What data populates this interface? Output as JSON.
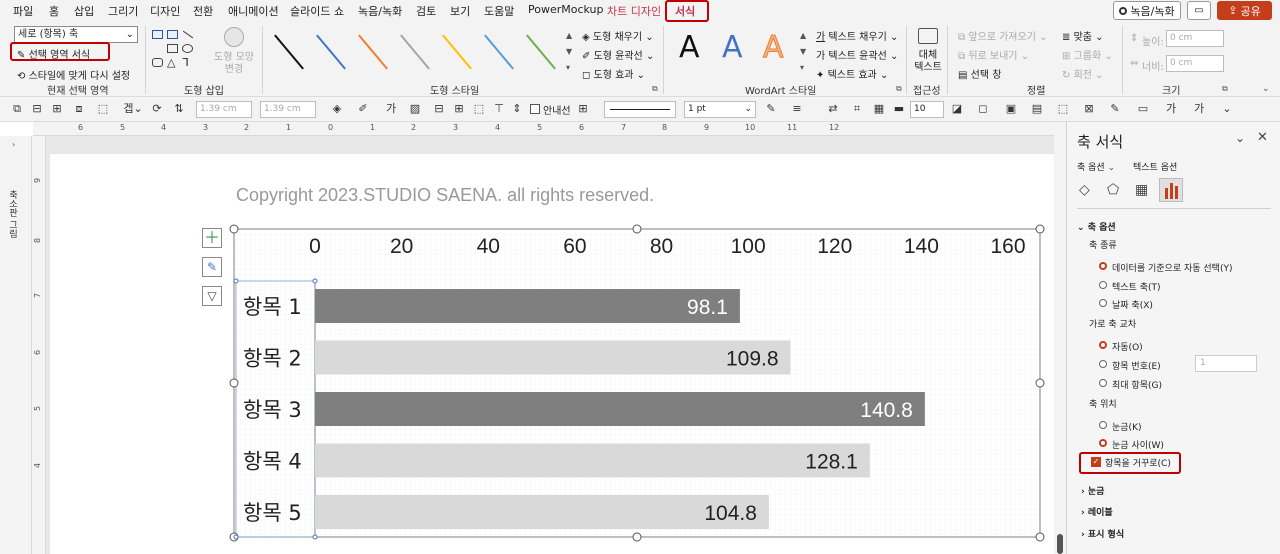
{
  "menu": {
    "items": [
      "파일",
      "홈",
      "삽입",
      "그리기",
      "디자인",
      "전환",
      "애니메이션",
      "슬라이드 쇼",
      "녹음/녹화",
      "검토",
      "보기",
      "도움말",
      "PowerMockup",
      "차트 디자인",
      "서식"
    ],
    "record_label": "녹음/녹화",
    "share_label": "공유"
  },
  "ribbon": {
    "current_selection": {
      "dropdown_value": "세로 (항목) 축",
      "format_selection": "선택 영역 서식",
      "reset_style": "스타일에 맞게 다시 설정",
      "label": "현재 선택 영역"
    },
    "insert_shapes": {
      "edit_shape": "도형 모양 변경",
      "label": "도형 삽입"
    },
    "shape_styles": {
      "fill": "도형 채우기",
      "outline": "도형 윤곽선",
      "effects": "도형 효과",
      "label": "도형 스타일"
    },
    "wordart": {
      "letter": "A",
      "text_fill": "텍스트 채우기",
      "text_outline": "텍스트 윤곽선",
      "text_effects": "텍스트 효과",
      "label": "WordArt 스타일"
    },
    "accessibility": {
      "alt_text": "대체 텍스트",
      "label": "접근성"
    },
    "arrange": {
      "bring_forward": "앞으로 가져오기",
      "send_backward": "뒤로 보내기",
      "selection_pane": "선택 창",
      "align": "맞춤",
      "group": "그룹화",
      "rotate": "회전",
      "label": "정렬"
    },
    "size": {
      "height_label": "높이:",
      "height_value": "0 cm",
      "width_label": "너비:",
      "width_value": "0 cm",
      "label": "크기"
    }
  },
  "toolbar2": {
    "width_a": "1.39 cm",
    "width_b": "1.39 cm",
    "guides": "안내선",
    "line_weight": "1 pt",
    "font_size": "10"
  },
  "ruler": {
    "h_ticks": [
      "6",
      "5",
      "4",
      "3",
      "2",
      "1",
      "0",
      "1",
      "2",
      "3",
      "4",
      "5",
      "6",
      "7",
      "8",
      "9",
      "10",
      "11",
      "12"
    ],
    "v_ticks": [
      "9",
      "8",
      "7",
      "6",
      "5",
      "4"
    ]
  },
  "left_strip": {
    "label": "축소판 그림"
  },
  "slide": {
    "copyright": "Copyright 2023.STUDIO SAENA. all rights reserved."
  },
  "chart_data": {
    "type": "bar",
    "orientation": "horizontal",
    "categories": [
      "항목 1",
      "항목 2",
      "항목 3",
      "항목 4",
      "항목 5"
    ],
    "values": [
      98.1,
      109.8,
      140.8,
      128.1,
      104.8
    ],
    "data_labels": [
      "98.1",
      "109.8",
      "140.8",
      "128.1",
      "104.8"
    ],
    "x_ticks": [
      "0",
      "20",
      "40",
      "60",
      "80",
      "100",
      "120",
      "140",
      "160"
    ],
    "xlim": [
      0,
      160
    ],
    "x_axis_position": "top",
    "categories_reversed": true,
    "bar_colors": [
      "#7f7f7f",
      "#d9d9d9",
      "#7f7f7f",
      "#d9d9d9",
      "#d9d9d9"
    ],
    "label_colors": [
      "#ffffff",
      "#222222",
      "#ffffff",
      "#222222",
      "#222222"
    ]
  },
  "pane": {
    "title": "축 서식",
    "tab_axis": "축 옵션",
    "tab_text": "텍스트 옵션",
    "section_axis": "축 옵션",
    "axis_type": "축 종류",
    "opt_auto": "데이터를 기준으로 자동 선택(Y)",
    "opt_text": "텍스트 축(T)",
    "opt_date": "날짜 축(X)",
    "cross": "가로 축 교차",
    "cross_auto": "자동(O)",
    "cross_num": "항목 번호(E)",
    "cross_num_value": "1",
    "cross_max": "최대 항목(G)",
    "axis_pos": "축 위치",
    "pos_on": "눈금(K)",
    "pos_between": "눈금 사이(W)",
    "reverse": "항목을 거꾸로(C)",
    "sec_ticks": "눈금",
    "sec_labels": "레이블",
    "sec_number": "표시 형식"
  },
  "colors": {
    "accent": "#c43e1c",
    "highlight": "#c00000",
    "bar_dark": "#7f7f7f",
    "bar_light": "#d9d9d9"
  }
}
